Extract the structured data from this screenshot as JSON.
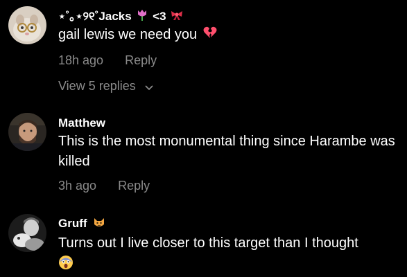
{
  "comments": [
    {
      "username": "⋆˚｡⋆୨୧˚Jacks",
      "username_suffix": "<3",
      "text": "gail lewis we need you",
      "time": "18h ago",
      "reply_label": "Reply",
      "view_replies_label": "View 5 replies",
      "icons": [
        "tulip-emoji",
        "ribbon-emoji",
        "broken-heart-emoji"
      ]
    },
    {
      "username": "Matthew",
      "text": "This is the most monumental thing since Harambe was killed",
      "time": "3h ago",
      "reply_label": "Reply"
    },
    {
      "username": "Gruff",
      "text": "Turns out I live closer to this target than I thought",
      "icons": [
        "cat-emoji",
        "screaming-face-emoji"
      ]
    }
  ],
  "colors": {
    "background": "#000000",
    "primary_text": "#ffffff",
    "secondary_text": "#8a8a8a"
  }
}
